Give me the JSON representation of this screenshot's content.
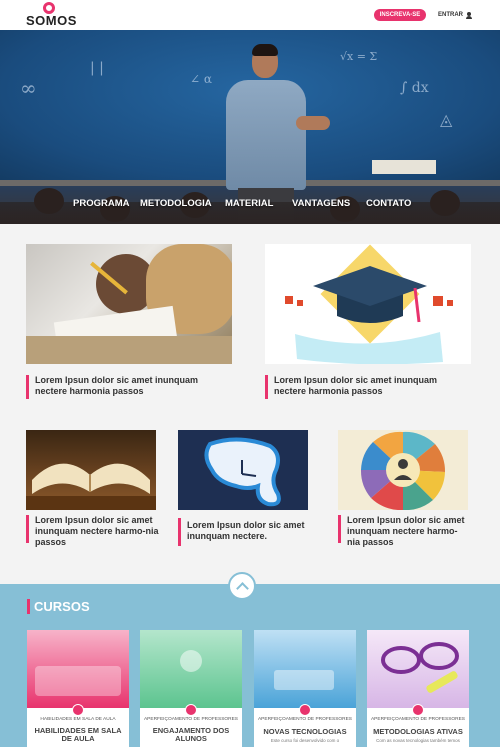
{
  "header": {
    "logo_text": "SOMOS",
    "subscribe_label": "INSCREVA-SE",
    "login_label": "ENTRAR",
    "login_icon": "user-icon"
  },
  "hero": {
    "nav": [
      "PROGRAMA",
      "METODOLOGIA",
      "MATERIAL",
      "VANTAGENS",
      "CONTATO"
    ]
  },
  "features": {
    "big": [
      {
        "caption": "Lorem Ipsun dolor sic amet inunquam nectere harmonia passos",
        "image": "student-writing-photo"
      },
      {
        "caption": "Lorem Ipsun dolor sic amet inunquam nectere harmonia passos",
        "image": "graduation-cap-illustration"
      }
    ],
    "small": [
      {
        "caption": "Lorem Ipsun dolor sic amet inunquam nectere harmo-nia passos",
        "image": "open-book-photo"
      },
      {
        "caption": "Lorem Ipsun dolor sic amet inunquam nectere.",
        "image": "melting-clock-illustration"
      },
      {
        "caption": "Lorem Ipsun dolor sic amet inunquam nectere harmo-nia passos",
        "image": "icons-circle-illustration"
      }
    ]
  },
  "cursos": {
    "title": "CURSOS",
    "items": [
      {
        "category": "HABILIDADES EM SALA DE AULA",
        "name": "HABILIDADES EM SALA DE AULA",
        "desc": "",
        "tint": "#e8336d"
      },
      {
        "category": "APERFEIÇOAMENTO DE PROFESSORES",
        "name": "ENGAJAMENTO DOS ALUNOS",
        "desc": "",
        "tint": "#5cc48f"
      },
      {
        "category": "APERFEIÇOAMENTO DE PROFESSORES",
        "name": "NOVAS TECNOLOGIAS",
        "desc": "Este curso foi desenvolvido com o",
        "tint": "#4aa3d8"
      },
      {
        "category": "APERFEIÇOAMENTO DE PROFESSORES",
        "name": "METODOLOGIAS ATIVAS",
        "desc": "Com as novas tecnologias também temos",
        "tint": "#a35ec4"
      }
    ]
  },
  "colors": {
    "accent": "#e8336d",
    "cursos_bg": "#86bfd6"
  }
}
